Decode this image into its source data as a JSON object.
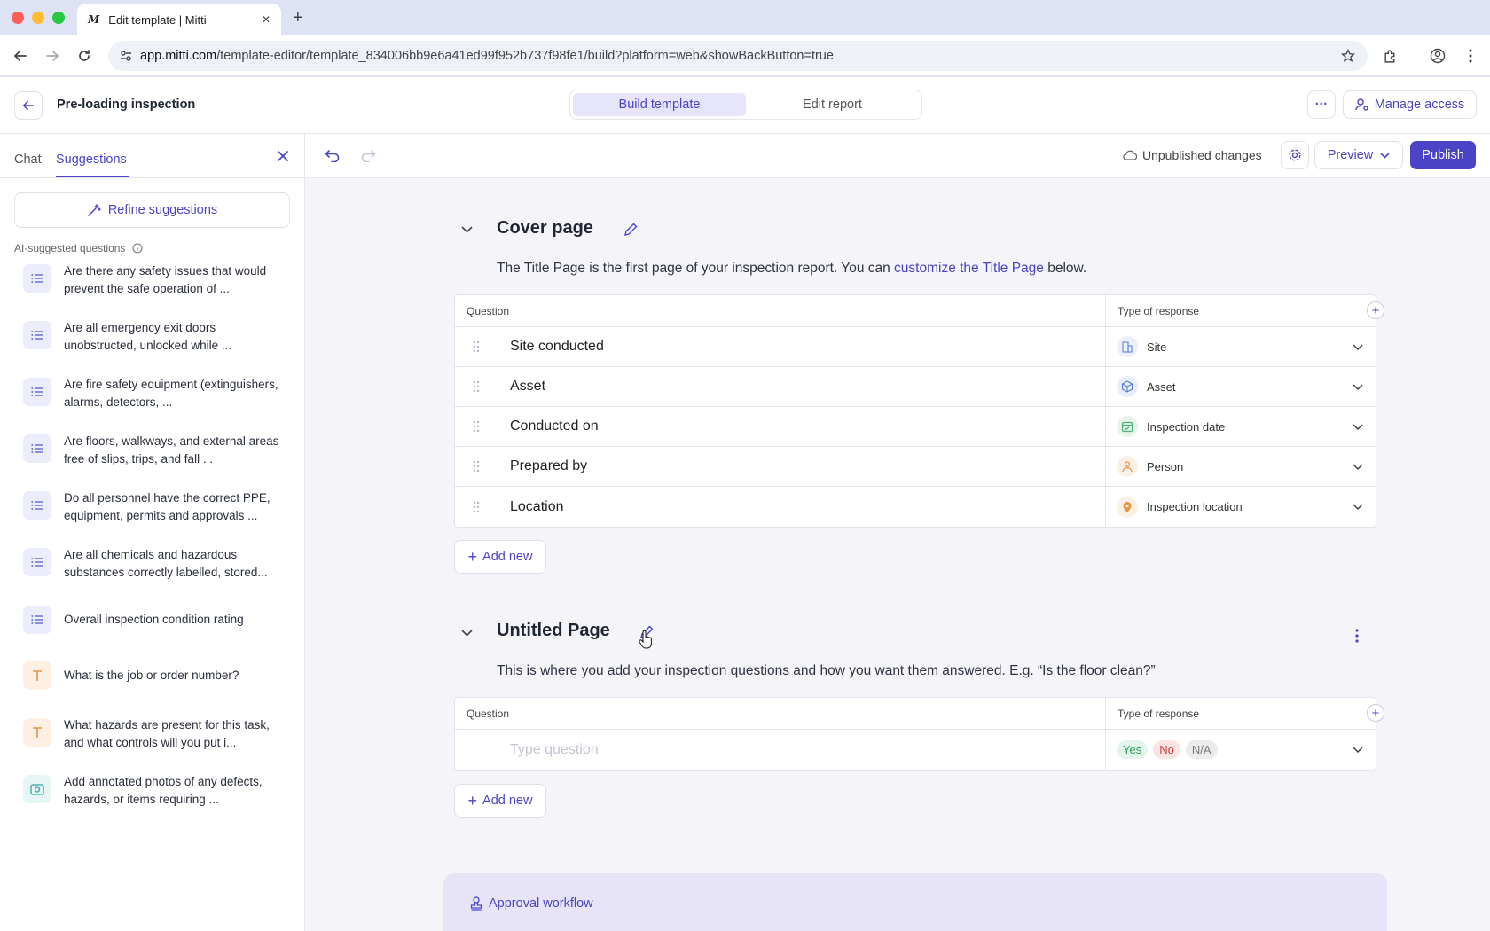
{
  "browser": {
    "tab_logo": "M",
    "tab_title": "Edit template | Mitti",
    "close_tab": "✕",
    "new_tab": "+",
    "url_host": "app.mitti.com",
    "url_path": "/template-editor/template_834006bb9e6a41ed99f952b737f98fe1/build?platform=web&showBackButton=true"
  },
  "appbar": {
    "title": "Pre-loading inspection",
    "tabs": [
      "Build template",
      "Edit report"
    ],
    "more": "···",
    "manage_access": "Manage access"
  },
  "sidebar": {
    "tabs": [
      "Chat",
      "Suggestions"
    ],
    "refine": "Refine suggestions",
    "ai_label": "AI-suggested questions",
    "items": [
      {
        "type": "list",
        "text": "Are there any safety issues that would prevent the safe operation of ..."
      },
      {
        "type": "list",
        "text": "Are all emergency exit doors unobstructed, unlocked while ..."
      },
      {
        "type": "list",
        "text": "Are fire safety equipment (extinguishers, alarms, detectors, ..."
      },
      {
        "type": "list",
        "text": "Are floors, walkways, and external areas free of slips, trips, and fall ..."
      },
      {
        "type": "list",
        "text": "Do all personnel have the correct PPE, equipment, permits and approvals ..."
      },
      {
        "type": "list",
        "text": "Are all chemicals and hazardous substances correctly labelled, stored..."
      },
      {
        "type": "list",
        "text": "Overall inspection condition rating"
      },
      {
        "type": "text",
        "text": "What is the job or order number?"
      },
      {
        "type": "text",
        "text": "What hazards are present for this task, and what controls will you put i..."
      },
      {
        "type": "photo",
        "text": "Add annotated photos of any defects, hazards, or items requiring ..."
      }
    ]
  },
  "toolbar": {
    "status": "Unpublished changes",
    "preview": "Preview",
    "publish": "Publish"
  },
  "cover": {
    "title": "Cover page",
    "desc_before": "The Title Page is the first page of your inspection report. You can ",
    "desc_link": "customize the Title Page",
    "desc_after": " below.",
    "col_question": "Question",
    "col_response": "Type of response",
    "rows": [
      {
        "question": "Site conducted",
        "response": "Site",
        "icon": "site-icon",
        "color": "#6b8fd8"
      },
      {
        "question": "Asset",
        "response": "Asset",
        "icon": "cube-icon",
        "color": "#5b7fd8"
      },
      {
        "question": "Conducted on",
        "response": "Inspection date",
        "icon": "calendar-icon",
        "color": "#4caf70"
      },
      {
        "question": "Prepared by",
        "response": "Person",
        "icon": "person-icon",
        "color": "#e9923f"
      },
      {
        "question": "Location",
        "response": "Inspection location",
        "icon": "pin-icon",
        "color": "#e9923f"
      }
    ],
    "add_new": "Add new"
  },
  "untitled": {
    "title": "Untitled Page",
    "desc": "This is where you add your inspection questions and how you want them answered. E.g. “Is the floor clean?”",
    "col_question": "Question",
    "col_response": "Type of response",
    "placeholder": "Type question",
    "pills": [
      "Yes",
      "No",
      "N/A"
    ],
    "add_new": "Add new"
  },
  "approval": {
    "label": "Approval workflow"
  },
  "colors": {
    "accent": "#4b44c7",
    "accent_soft": "#e7e5fb"
  }
}
